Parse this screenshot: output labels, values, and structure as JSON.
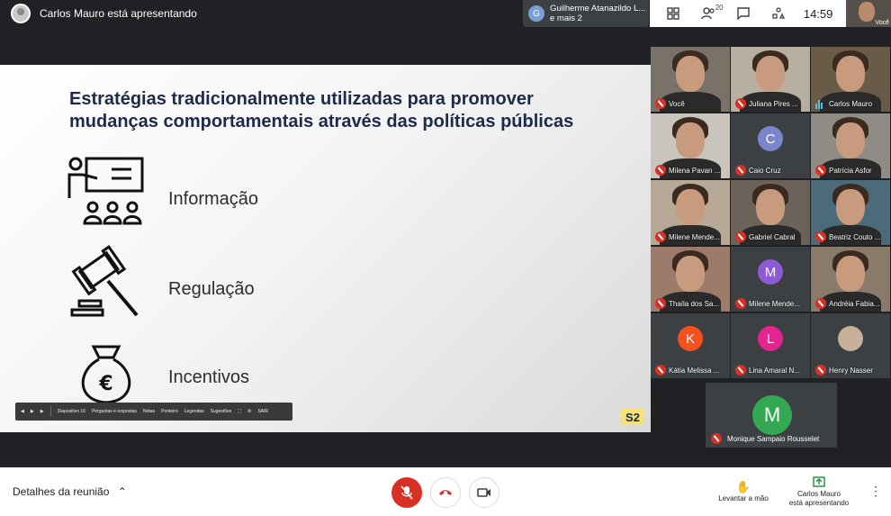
{
  "top": {
    "presenter_text": "Carlos Mauro está apresentando",
    "speaking_initial": "G",
    "speaking_line1": "Guilherme Atanazildo L...",
    "speaking_line2": "e mais 2",
    "people_count": "20",
    "clock": "14:59",
    "self_label": "Você"
  },
  "slide": {
    "title": "Estratégias tradicionalmente utilizadas para promover mudanças comportamentais através das políticas públicas",
    "items": [
      "Informação",
      "Regulação",
      "Incentivos"
    ],
    "badge": "S2",
    "controls": {
      "slide_label": "Diapositivo 16",
      "qa": "Perguntas e respostas",
      "notes": "Notas",
      "pointer": "Ponteiro",
      "captions": "Legendas",
      "suggestions": "Sugestões",
      "exit": "SAIR"
    }
  },
  "participants": [
    {
      "name": "Você",
      "type": "video",
      "muted": true
    },
    {
      "name": "Juliana Pires ...",
      "type": "video",
      "muted": true
    },
    {
      "name": "Carlos Mauro",
      "type": "video",
      "muted": false
    },
    {
      "name": "Milena Pavan ...",
      "type": "video",
      "muted": true
    },
    {
      "name": "Caio Cruz",
      "type": "letter",
      "letter": "C",
      "color": "#7986cb",
      "muted": true
    },
    {
      "name": "Patrícia Asfor",
      "type": "video",
      "muted": true
    },
    {
      "name": "Milene Mende...",
      "type": "video",
      "muted": true
    },
    {
      "name": "Gabriel Cabral",
      "type": "video",
      "muted": true
    },
    {
      "name": "Beatriz Couto ...",
      "type": "video",
      "muted": true
    },
    {
      "name": "Thaíla dos Sa...",
      "type": "video",
      "muted": true
    },
    {
      "name": "Milene Mende...",
      "type": "letter",
      "letter": "M",
      "color": "#8e5bd6",
      "muted": true
    },
    {
      "name": "Andréia Fabia...",
      "type": "video",
      "muted": true
    },
    {
      "name": "Kátia Melissa ...",
      "type": "letter",
      "letter": "K",
      "color": "#f4511e",
      "muted": true
    },
    {
      "name": "Lina Amaral N...",
      "type": "letter",
      "letter": "L",
      "color": "#e52592",
      "muted": true
    },
    {
      "name": "Henry Nasser",
      "type": "photo",
      "muted": true
    }
  ],
  "big_tile": {
    "name": "Monique Sampaio Rousselet",
    "letter": "M",
    "color": "#34a853"
  },
  "bottom": {
    "details": "Detalhes da reunião",
    "raise_hand": "Levantar a mão",
    "presenting_line1": "Carlos Mauro",
    "presenting_line2": "está apresentando"
  }
}
